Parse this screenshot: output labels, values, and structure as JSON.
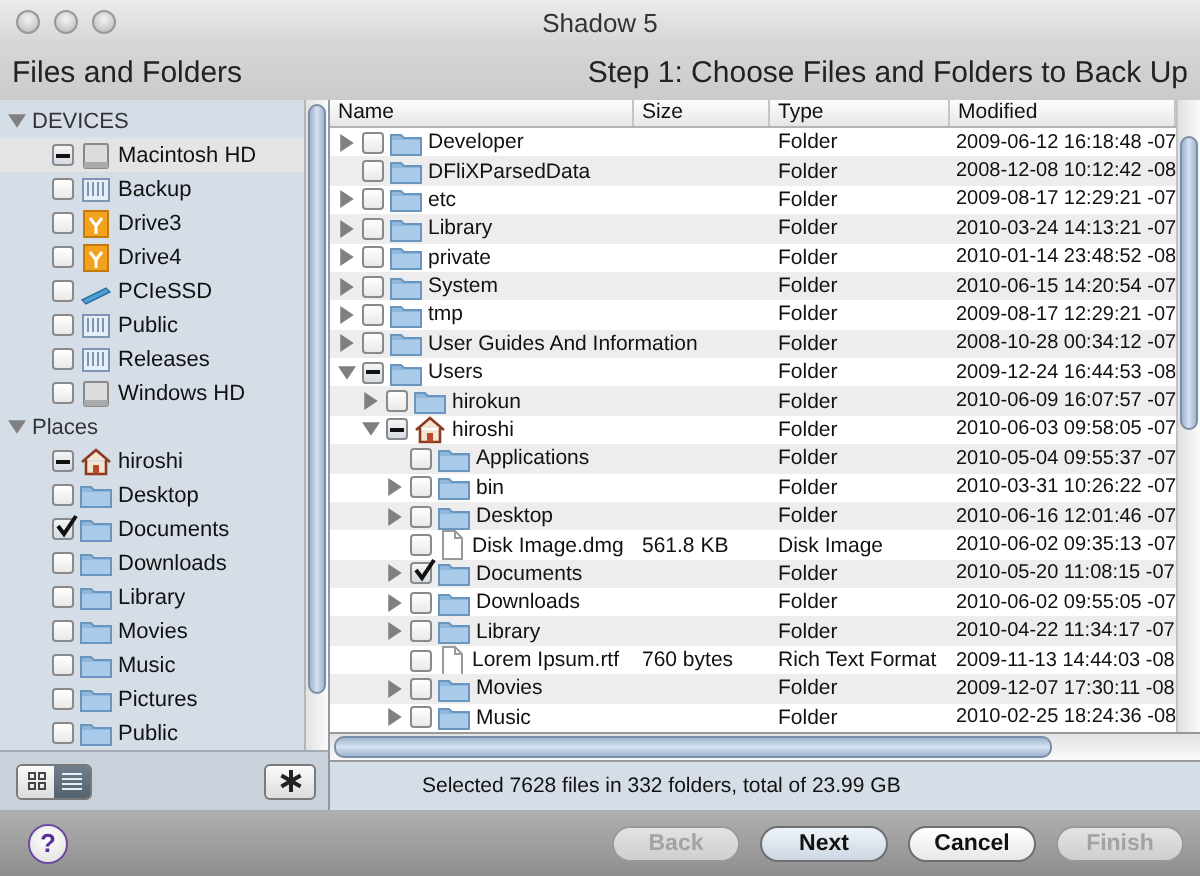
{
  "window": {
    "title": "Shadow 5"
  },
  "header": {
    "title": "Files and Folders",
    "step": "Step 1: Choose Files and Folders to Back Up"
  },
  "sidebar": {
    "sections": [
      {
        "label": "DEVICES",
        "expanded": true,
        "items": [
          {
            "label": "Macintosh HD",
            "kind": "disk",
            "checked": true,
            "mixed": true,
            "selected": true
          },
          {
            "label": "Backup",
            "kind": "server",
            "checked": false,
            "mixed": false,
            "selected": false
          },
          {
            "label": "Drive3",
            "kind": "external",
            "checked": false,
            "mixed": false,
            "selected": false
          },
          {
            "label": "Drive4",
            "kind": "external",
            "checked": false,
            "mixed": false,
            "selected": false
          },
          {
            "label": "PCIeSSD",
            "kind": "card",
            "checked": false,
            "mixed": false,
            "selected": false
          },
          {
            "label": "Public",
            "kind": "server",
            "checked": false,
            "mixed": false,
            "selected": false
          },
          {
            "label": "Releases",
            "kind": "server",
            "checked": false,
            "mixed": false,
            "selected": false
          },
          {
            "label": "Windows HD",
            "kind": "disk",
            "checked": false,
            "mixed": false,
            "selected": false
          }
        ]
      },
      {
        "label": "Places",
        "expanded": true,
        "items": [
          {
            "label": "hiroshi",
            "kind": "home",
            "checked": true,
            "mixed": true,
            "selected": false
          },
          {
            "label": "Desktop",
            "kind": "folder",
            "checked": false,
            "mixed": false,
            "selected": false
          },
          {
            "label": "Documents",
            "kind": "folder",
            "checked": true,
            "mixed": false,
            "selected": false
          },
          {
            "label": "Downloads",
            "kind": "folder",
            "checked": false,
            "mixed": false,
            "selected": false
          },
          {
            "label": "Library",
            "kind": "folder",
            "checked": false,
            "mixed": false,
            "selected": false
          },
          {
            "label": "Movies",
            "kind": "folder",
            "checked": false,
            "mixed": false,
            "selected": false
          },
          {
            "label": "Music",
            "kind": "folder",
            "checked": false,
            "mixed": false,
            "selected": false
          },
          {
            "label": "Pictures",
            "kind": "folder",
            "checked": false,
            "mixed": false,
            "selected": false
          },
          {
            "label": "Public",
            "kind": "folder",
            "checked": false,
            "mixed": false,
            "selected": false
          }
        ]
      }
    ]
  },
  "view_toggle": [
    {
      "kind": "grid",
      "selected": false
    },
    {
      "kind": "list",
      "selected": true
    }
  ],
  "table": {
    "columns": [
      "Name",
      "Size",
      "Type",
      "Modified"
    ],
    "rows": [
      {
        "name": "Developer",
        "kind": "folder",
        "checked": false,
        "mixed": false,
        "expanded": false,
        "type": "Folder",
        "modified": "2009-06-12 16:18:48 -07"
      },
      {
        "name": "DFliXParsedData",
        "kind": "folder",
        "checked": false,
        "mixed": false,
        "type": "Folder",
        "modified": "2008-12-08 10:12:42 -08"
      },
      {
        "name": "etc",
        "kind": "folder",
        "checked": false,
        "mixed": false,
        "expanded": false,
        "type": "Folder",
        "modified": "2009-08-17 12:29:21 -07"
      },
      {
        "name": "Library",
        "kind": "folder",
        "checked": false,
        "mixed": false,
        "expanded": false,
        "type": "Folder",
        "modified": "2010-03-24 14:13:21 -07"
      },
      {
        "name": "private",
        "kind": "folder",
        "checked": false,
        "mixed": false,
        "expanded": false,
        "type": "Folder",
        "modified": "2010-01-14 23:48:52 -08"
      },
      {
        "name": "System",
        "kind": "folder",
        "checked": false,
        "mixed": false,
        "expanded": false,
        "type": "Folder",
        "modified": "2010-06-15 14:20:54 -07"
      },
      {
        "name": "tmp",
        "kind": "folder",
        "checked": false,
        "mixed": false,
        "expanded": false,
        "type": "Folder",
        "modified": "2009-08-17 12:29:21 -07"
      },
      {
        "name": "User Guides And Information",
        "kind": "folder",
        "checked": false,
        "mixed": false,
        "expanded": false,
        "type": "Folder",
        "modified": "2008-10-28 00:34:12 -07"
      },
      {
        "name": "Users",
        "kind": "folder",
        "checked": true,
        "mixed": true,
        "expanded": true,
        "type": "Folder",
        "modified": "2009-12-24 16:44:53 -08",
        "children": [
          {
            "name": "hirokun",
            "kind": "folder",
            "checked": false,
            "mixed": false,
            "expanded": false,
            "type": "Folder",
            "modified": "2010-06-09 16:07:57 -07"
          },
          {
            "name": "hiroshi",
            "kind": "home",
            "checked": true,
            "mixed": true,
            "expanded": true,
            "type": "Folder",
            "modified": "2010-06-03 09:58:05 -07",
            "children": [
              {
                "name": "Applications",
                "kind": "folder",
                "checked": false,
                "mixed": false,
                "type": "Folder",
                "modified": "2010-05-04 09:55:37 -07"
              },
              {
                "name": "bin",
                "kind": "folder",
                "checked": false,
                "mixed": false,
                "expanded": false,
                "type": "Folder",
                "modified": "2010-03-31 10:26:22 -07"
              },
              {
                "name": "Desktop",
                "kind": "folder",
                "checked": false,
                "mixed": false,
                "expanded": false,
                "type": "Folder",
                "modified": "2010-06-16 12:01:46 -07"
              },
              {
                "name": "Disk Image.dmg",
                "kind": "file",
                "checked": false,
                "mixed": false,
                "size": "561.8 KB",
                "type": "Disk Image",
                "modified": "2010-06-02 09:35:13 -07"
              },
              {
                "name": "Documents",
                "kind": "folder",
                "checked": true,
                "mixed": false,
                "expanded": false,
                "type": "Folder",
                "modified": "2010-05-20 11:08:15 -07"
              },
              {
                "name": "Downloads",
                "kind": "folder",
                "checked": false,
                "mixed": false,
                "expanded": false,
                "type": "Folder",
                "modified": "2010-06-02 09:55:05 -07"
              },
              {
                "name": "Library",
                "kind": "folder",
                "checked": false,
                "mixed": false,
                "expanded": false,
                "type": "Folder",
                "modified": "2010-04-22 11:34:17 -07"
              },
              {
                "name": "Lorem Ipsum.rtf",
                "kind": "file",
                "checked": false,
                "mixed": false,
                "size": "760 bytes",
                "type": "Rich Text Format",
                "modified": "2009-11-13 14:44:03 -08"
              },
              {
                "name": "Movies",
                "kind": "folder",
                "checked": false,
                "mixed": false,
                "expanded": false,
                "type": "Folder",
                "modified": "2009-12-07 17:30:11 -08"
              },
              {
                "name": "Music",
                "kind": "folder",
                "checked": false,
                "mixed": false,
                "expanded": false,
                "type": "Folder",
                "modified": "2010-02-25 18:24:36 -08"
              }
            ]
          }
        ]
      }
    ]
  },
  "status": "Selected 7628 files in 332 folders, total of 23.99 GB",
  "help_button": "?",
  "buttons": [
    {
      "label": "Back",
      "disabled": true,
      "default": false
    },
    {
      "label": "Next",
      "disabled": false,
      "default": true
    },
    {
      "label": "Cancel",
      "disabled": false,
      "default": false
    },
    {
      "label": "Finish",
      "disabled": true,
      "default": false
    }
  ]
}
